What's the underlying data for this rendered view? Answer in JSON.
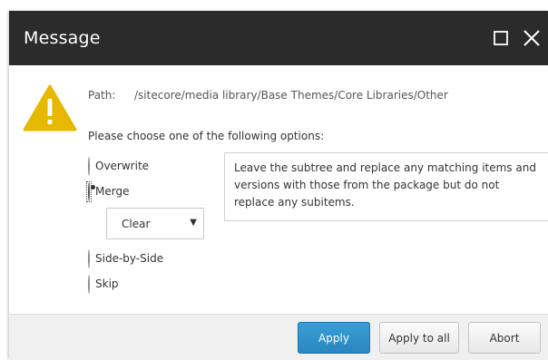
{
  "dialog": {
    "title": "Message",
    "maximize_icon": "maximize-icon",
    "close_icon": "close-icon"
  },
  "content": {
    "warning_icon": "warning-icon",
    "path_label": "Path:",
    "path_value": "/sitecore/media library/Base Themes/Core Libraries/Other",
    "prompt": "Please choose one of the following options:"
  },
  "options": [
    {
      "label": "Overwrite",
      "checked": false
    },
    {
      "label": "Merge",
      "checked": true
    },
    {
      "label": "Side-by-Side",
      "checked": false
    },
    {
      "label": "Skip",
      "checked": false
    }
  ],
  "merge_mode": {
    "selected": "Clear",
    "arrow": "▼"
  },
  "description": "Leave the subtree and replace any matching items and versions with those from the package but do not replace any subitems.",
  "buttons": {
    "apply": "Apply",
    "apply_to_all": "Apply to all",
    "abort": "Abort"
  },
  "colors": {
    "titlebar": "#2b2b2b",
    "primary_button": "#2a86bf",
    "warning": "#e6b800"
  }
}
